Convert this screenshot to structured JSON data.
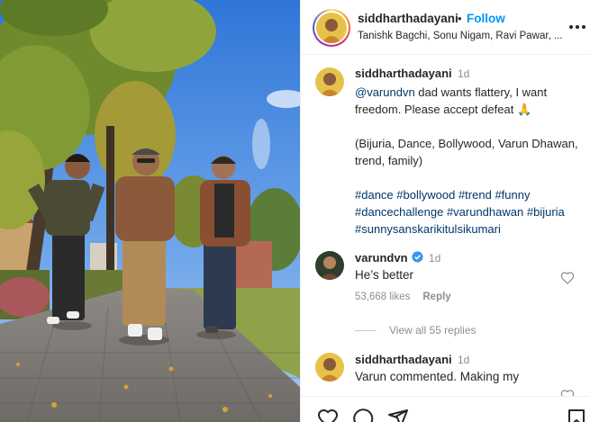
{
  "post_header": {
    "username": "siddharthadayani",
    "separator": "•",
    "follow_label": "Follow",
    "subtitle": "Tanishk Bagchi, Sonu Nigam, Ravi Pawar, ..."
  },
  "caption": {
    "username": "siddharthadayani",
    "time": "1d",
    "mention": "@varundvn",
    "text": " dad wants flattery, I want freedom. Please accept defeat ",
    "emoji": "🙏",
    "tags_line": "(Bijuria, Dance, Bollywood, Varun Dhawan, trend, family)",
    "hashtags": [
      "#dance",
      "#bollywood",
      "#trend",
      "#funny",
      "#dancechallenge",
      "#varundhawan",
      "#bijuria",
      "#sunnysanskarikitulsikumari"
    ]
  },
  "comments": [
    {
      "username": "varundvn",
      "verified": true,
      "time": "1d",
      "text": "He’s better",
      "likes": "53,668 likes",
      "reply_label": "Reply",
      "view_replies": "View all 55 replies"
    },
    {
      "username": "siddharthadayani",
      "time": "1d",
      "text": "Varun commented. Making my"
    }
  ],
  "actions": [
    "heart-icon",
    "comment-icon",
    "share-icon",
    "save-icon"
  ],
  "colors": {
    "link": "#00376b",
    "follow": "#0095f6",
    "muted": "#8e8e8e",
    "verified": "#3897f0"
  }
}
